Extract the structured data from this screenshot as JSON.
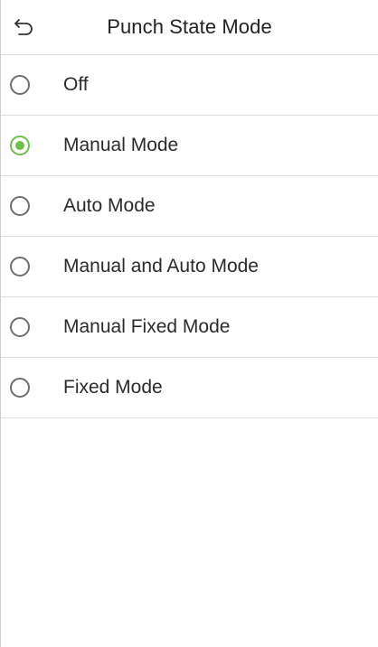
{
  "header": {
    "title": "Punch State Mode",
    "back_icon": "back-arrow-icon"
  },
  "colors": {
    "accent": "#6abf4b",
    "radio_border": "#6e6e6e",
    "divider": "#dcdcdc"
  },
  "options": [
    {
      "label": "Off",
      "selected": false
    },
    {
      "label": "Manual Mode",
      "selected": true
    },
    {
      "label": "Auto Mode",
      "selected": false
    },
    {
      "label": "Manual and Auto Mode",
      "selected": false
    },
    {
      "label": "Manual Fixed Mode",
      "selected": false
    },
    {
      "label": "Fixed Mode",
      "selected": false
    }
  ]
}
